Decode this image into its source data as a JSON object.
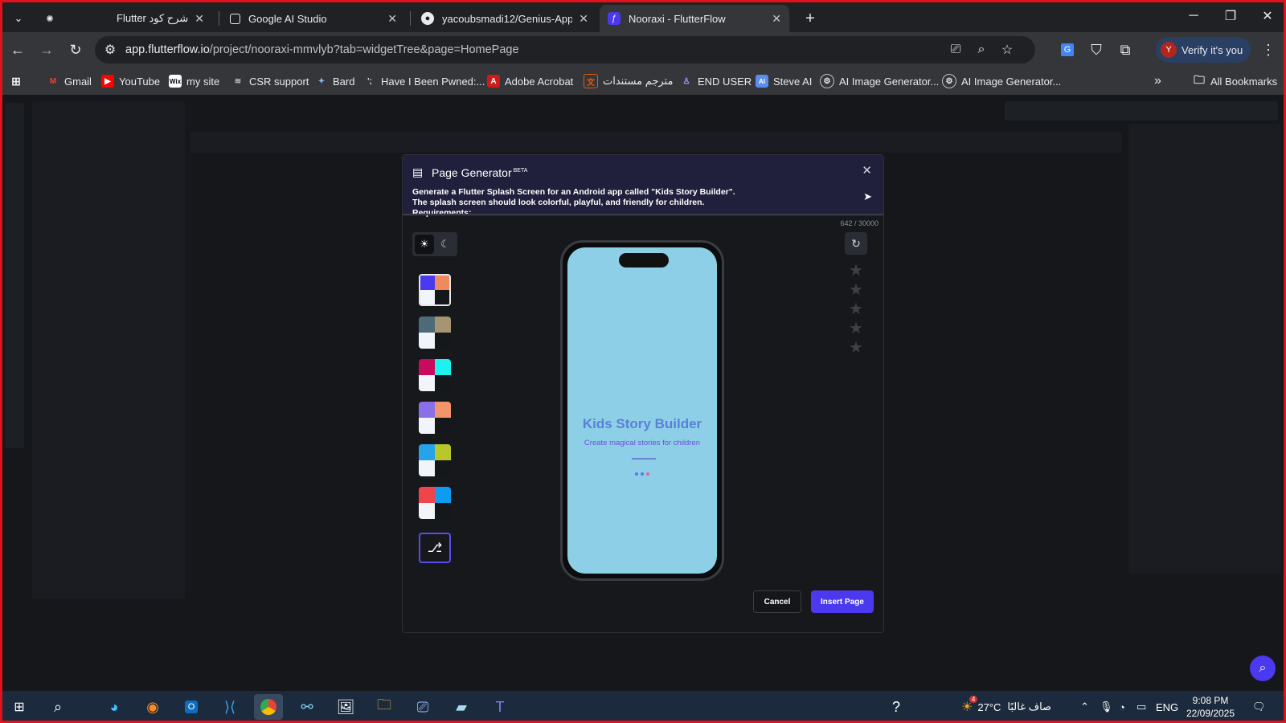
{
  "browser": {
    "tabs": [
      {
        "title": "Flutter شرح كود",
        "icon": "chatgpt-icon",
        "active": false
      },
      {
        "title": "Google AI Studio",
        "icon": "ai-studio-icon",
        "active": false
      },
      {
        "title": "yacoubsmadi12/Genius-Appio",
        "icon": "github-icon",
        "active": false
      },
      {
        "title": "Nooraxi - FlutterFlow",
        "icon": "flutterflow-icon",
        "active": true
      }
    ],
    "new_tab": "+",
    "url_host": "app.flutterflow.io",
    "url_path": "/project/nooraxi-mmvlyb?tab=widgetTree&page=HomePage",
    "verify_label": "Verify it's you",
    "verify_avatar": "Y",
    "bookmarks": [
      "Gmail",
      "YouTube",
      "my site",
      "CSR support",
      "Bard",
      "Have I Been Pwned:...",
      "Adobe Acrobat",
      "مترجم مستندات",
      "END USER",
      "Steve AI",
      "AI Image Generator...",
      "AI Image Generator..."
    ],
    "all_bookmarks": "All Bookmarks"
  },
  "dialog": {
    "title": "Page Generator",
    "badge": "BETA",
    "prompt_lines": [
      "Generate a Flutter Splash Screen for an Android app called \"Kids Story Builder\".",
      "The splash screen should look colorful, playful, and friendly for children.",
      "Requirements:"
    ],
    "char_count": "642 / 30000",
    "palettes": [
      [
        "#4b39ef",
        "#ef8a5f",
        "#f1f4f8",
        "#14181b"
      ],
      [
        "#4d6a78",
        "#a59571",
        "#f1f4f8",
        "#14181b"
      ],
      [
        "#c80b5e",
        "#1ef2ee",
        "#f1f4f8",
        "#14181b"
      ],
      [
        "#8a70e8",
        "#f2956a",
        "#f1f4f8",
        "#14181b"
      ],
      [
        "#27a3ec",
        "#b8c72a",
        "#f1f4f8",
        "#14181b"
      ],
      [
        "#f0444b",
        "#0f9bf0",
        "#f1f4f8",
        "#14181b"
      ]
    ],
    "preview": {
      "title": "Kids Story Builder",
      "subtitle": "Create magical stories for children",
      "background": "#8ecfe8",
      "dot_colors": [
        "#6a6ef0",
        "#4f7fe0",
        "#e85fa8"
      ]
    },
    "cancel_label": "Cancel",
    "insert_label": "Insert Page"
  },
  "taskbar": {
    "weather_temp": "27°C",
    "weather_text": "صاف غالبًا",
    "lang": "ENG",
    "time": "9:08 PM",
    "date": "22/09/2025",
    "outlook_badge": "4"
  },
  "colors": {
    "accent": "#4b39ef",
    "frame": "#e0121b"
  }
}
